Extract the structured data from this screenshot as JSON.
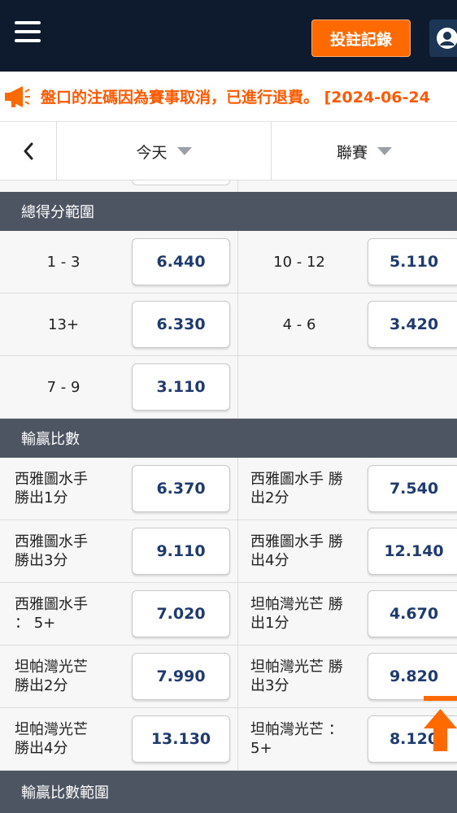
{
  "header": {
    "bet_record_label": "投註記錄",
    "menu_icon": "hamburger-menu-icon",
    "user_icon": "user-icon"
  },
  "marquee": {
    "icon": "megaphone-icon",
    "text": "盤口的注碼因為賽事取消，已進行退費。 [2024-06-24"
  },
  "filters": {
    "back_icon": "chevron-left-icon",
    "date_label": "今天",
    "league_label": "聯賽"
  },
  "sections": {
    "total_score_range": {
      "title": "總得分範圍",
      "rows": [
        [
          {
            "label": "1 - 3",
            "odds": "6.440"
          },
          {
            "label": "10 - 12",
            "odds": "5.110"
          }
        ],
        [
          {
            "label": "13+",
            "odds": "6.330"
          },
          {
            "label": "4 - 6",
            "odds": "3.420"
          }
        ],
        [
          {
            "label": "7 - 9",
            "odds": "3.110"
          }
        ]
      ]
    },
    "winning_margin": {
      "title": "輸贏比數",
      "rows": [
        [
          {
            "label_line1": "西雅圖水手",
            "label_line2": "勝出1分",
            "odds": "6.370"
          },
          {
            "label_line1": "西雅圖水手 勝",
            "label_line2": "出2分",
            "odds": "7.540"
          }
        ],
        [
          {
            "label_line1": "西雅圖水手",
            "label_line2": "勝出3分",
            "odds": "9.110"
          },
          {
            "label_line1": "西雅圖水手 勝",
            "label_line2": "出4分",
            "odds": "12.140"
          }
        ],
        [
          {
            "label_line1": "西雅圖水手",
            "label_line2": "： 5+",
            "odds": "7.020"
          },
          {
            "label_line1": "坦帕灣光芒 勝",
            "label_line2": "出1分",
            "odds": "4.670"
          }
        ],
        [
          {
            "label_line1": "坦帕灣光芒",
            "label_line2": "勝出2分",
            "odds": "7.990"
          },
          {
            "label_line1": "坦帕灣光芒 勝",
            "label_line2": "出3分",
            "odds": "9.820"
          }
        ],
        [
          {
            "label_line1": "坦帕灣光芒",
            "label_line2": "勝出4分",
            "odds": "13.130"
          },
          {
            "label_line1": "坦帕灣光芒 ：",
            "label_line2": "5+",
            "odds": "8.120"
          }
        ]
      ]
    },
    "winning_margin_range": {
      "title": "輸贏比數範圍"
    }
  },
  "scroll_top_icon": "arrow-up-icon",
  "colors": {
    "header_bg": "#0e1a2e",
    "accent": "#ff6a00",
    "section_header_bg": "#4d5563",
    "odds_text": "#1f3a6e"
  }
}
